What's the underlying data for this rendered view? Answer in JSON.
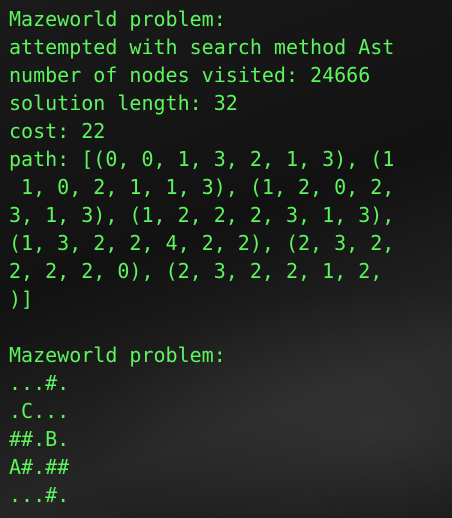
{
  "terminal": {
    "text_color": "#5cf55c",
    "background": "#121212",
    "lines": [
      "Mazeworld problem:",
      "attempted with search method Ast",
      "number of nodes visited: 24666",
      "solution length: 32",
      "cost: 22",
      "path: [(0, 0, 1, 3, 2, 1, 3), (1",
      " 1, 0, 2, 1, 1, 3), (1, 2, 0, 2,",
      "3, 1, 3), (1, 2, 2, 2, 3, 1, 3),",
      "(1, 3, 2, 2, 4, 2, 2), (2, 3, 2,",
      "2, 2, 2, 0), (2, 3, 2, 2, 1, 2,",
      ")]",
      "",
      "Mazeworld problem:",
      "...#.",
      ".C...",
      "##.B.",
      "A#.##",
      "...#."
    ]
  }
}
